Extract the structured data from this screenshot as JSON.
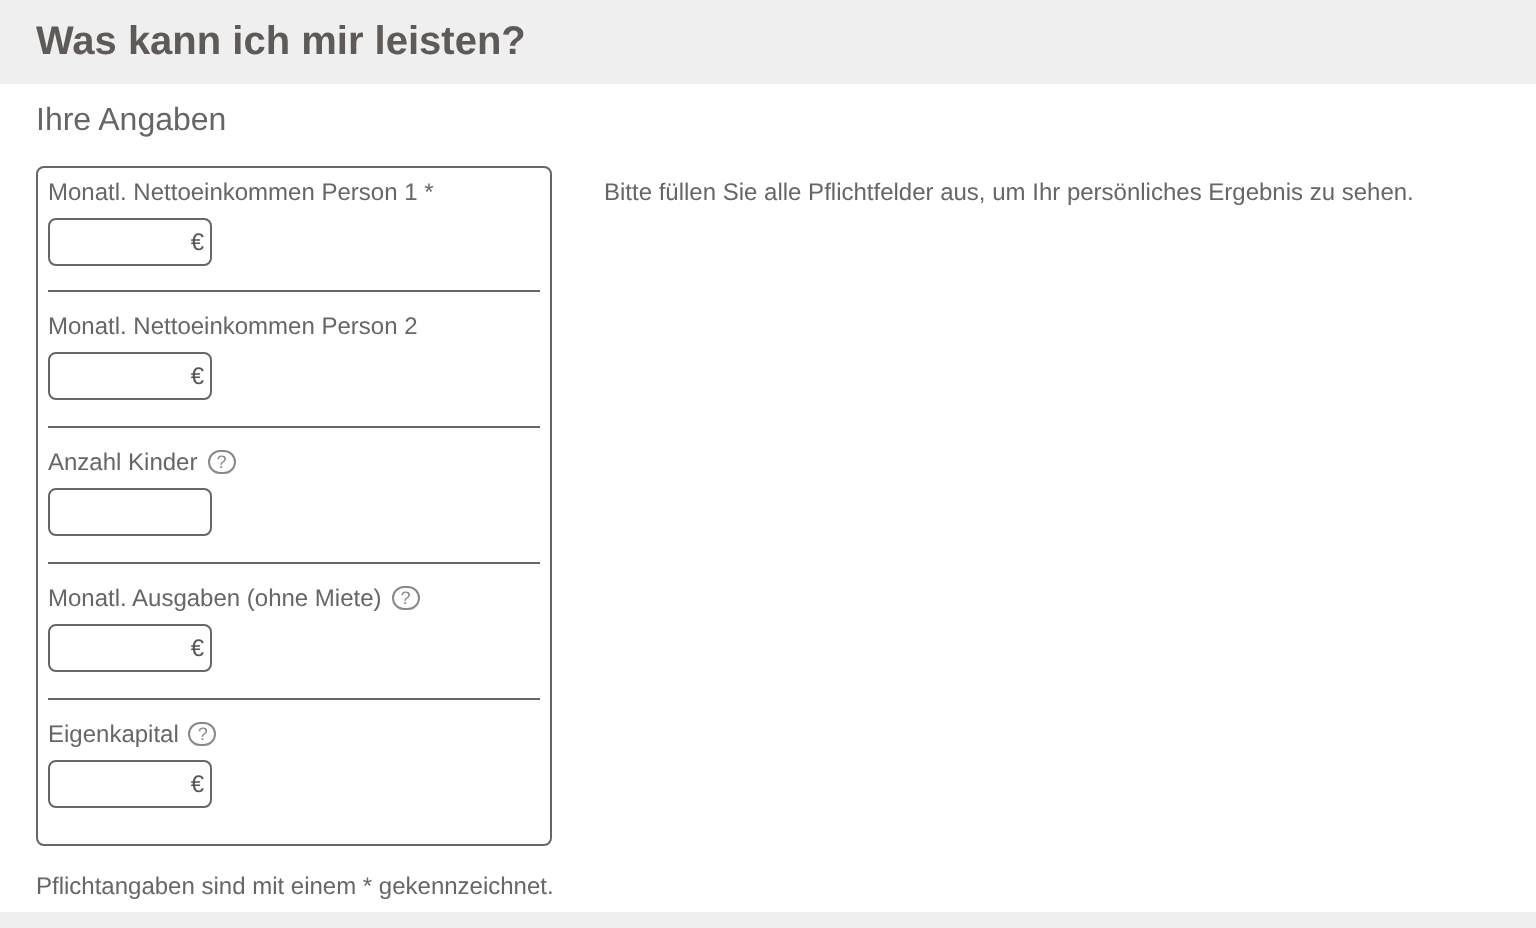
{
  "title": "Was kann ich mir leisten?",
  "section_title": "Ihre Angaben",
  "fields": [
    {
      "label": "Monatl. Nettoeinkommen Person 1 *",
      "unit": "€"
    },
    {
      "label": "Monatl. Nettoeinkommen Person 2",
      "unit": "€"
    },
    {
      "label": "Anzahl Kinder",
      "help": "?"
    },
    {
      "label": "Monatl. Ausgaben (ohne Miete)",
      "help": "?",
      "unit": "€"
    },
    {
      "label": "Eigenkapital",
      "help": "?",
      "unit": "€"
    }
  ],
  "result_hint": "Bitte füllen Sie alle Pflichtfelder aus, um Ihr persönliches Ergebnis zu sehen.",
  "footnote": "Pflichtangaben sind mit einem * gekennzeichnet."
}
